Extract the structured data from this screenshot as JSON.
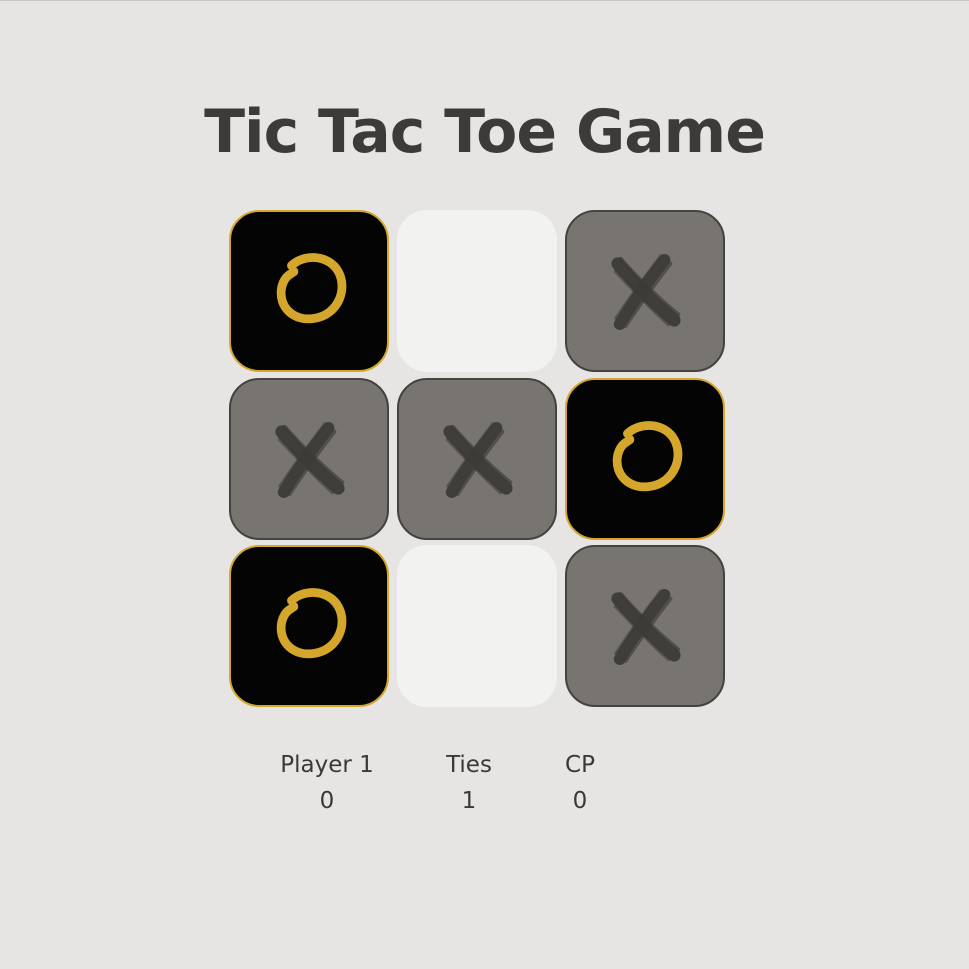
{
  "title": "Tic Tac Toe Game",
  "colors": {
    "background": "#e6e5e4",
    "empty_cell": "#f2f2f1",
    "x_cell": "#787570",
    "x_mark": "#3d3b38",
    "o_cell": "#040404",
    "o_mark": "#d4a72c",
    "text": "#3d3b38"
  },
  "board": {
    "cells": [
      "O",
      "",
      "X",
      "X",
      "X",
      "O",
      "O",
      "",
      "X"
    ]
  },
  "scores": {
    "player1": {
      "label": "Player 1",
      "value": "0"
    },
    "ties": {
      "label": "Ties",
      "value": "1"
    },
    "cp": {
      "label": "CP",
      "value": "0"
    }
  }
}
